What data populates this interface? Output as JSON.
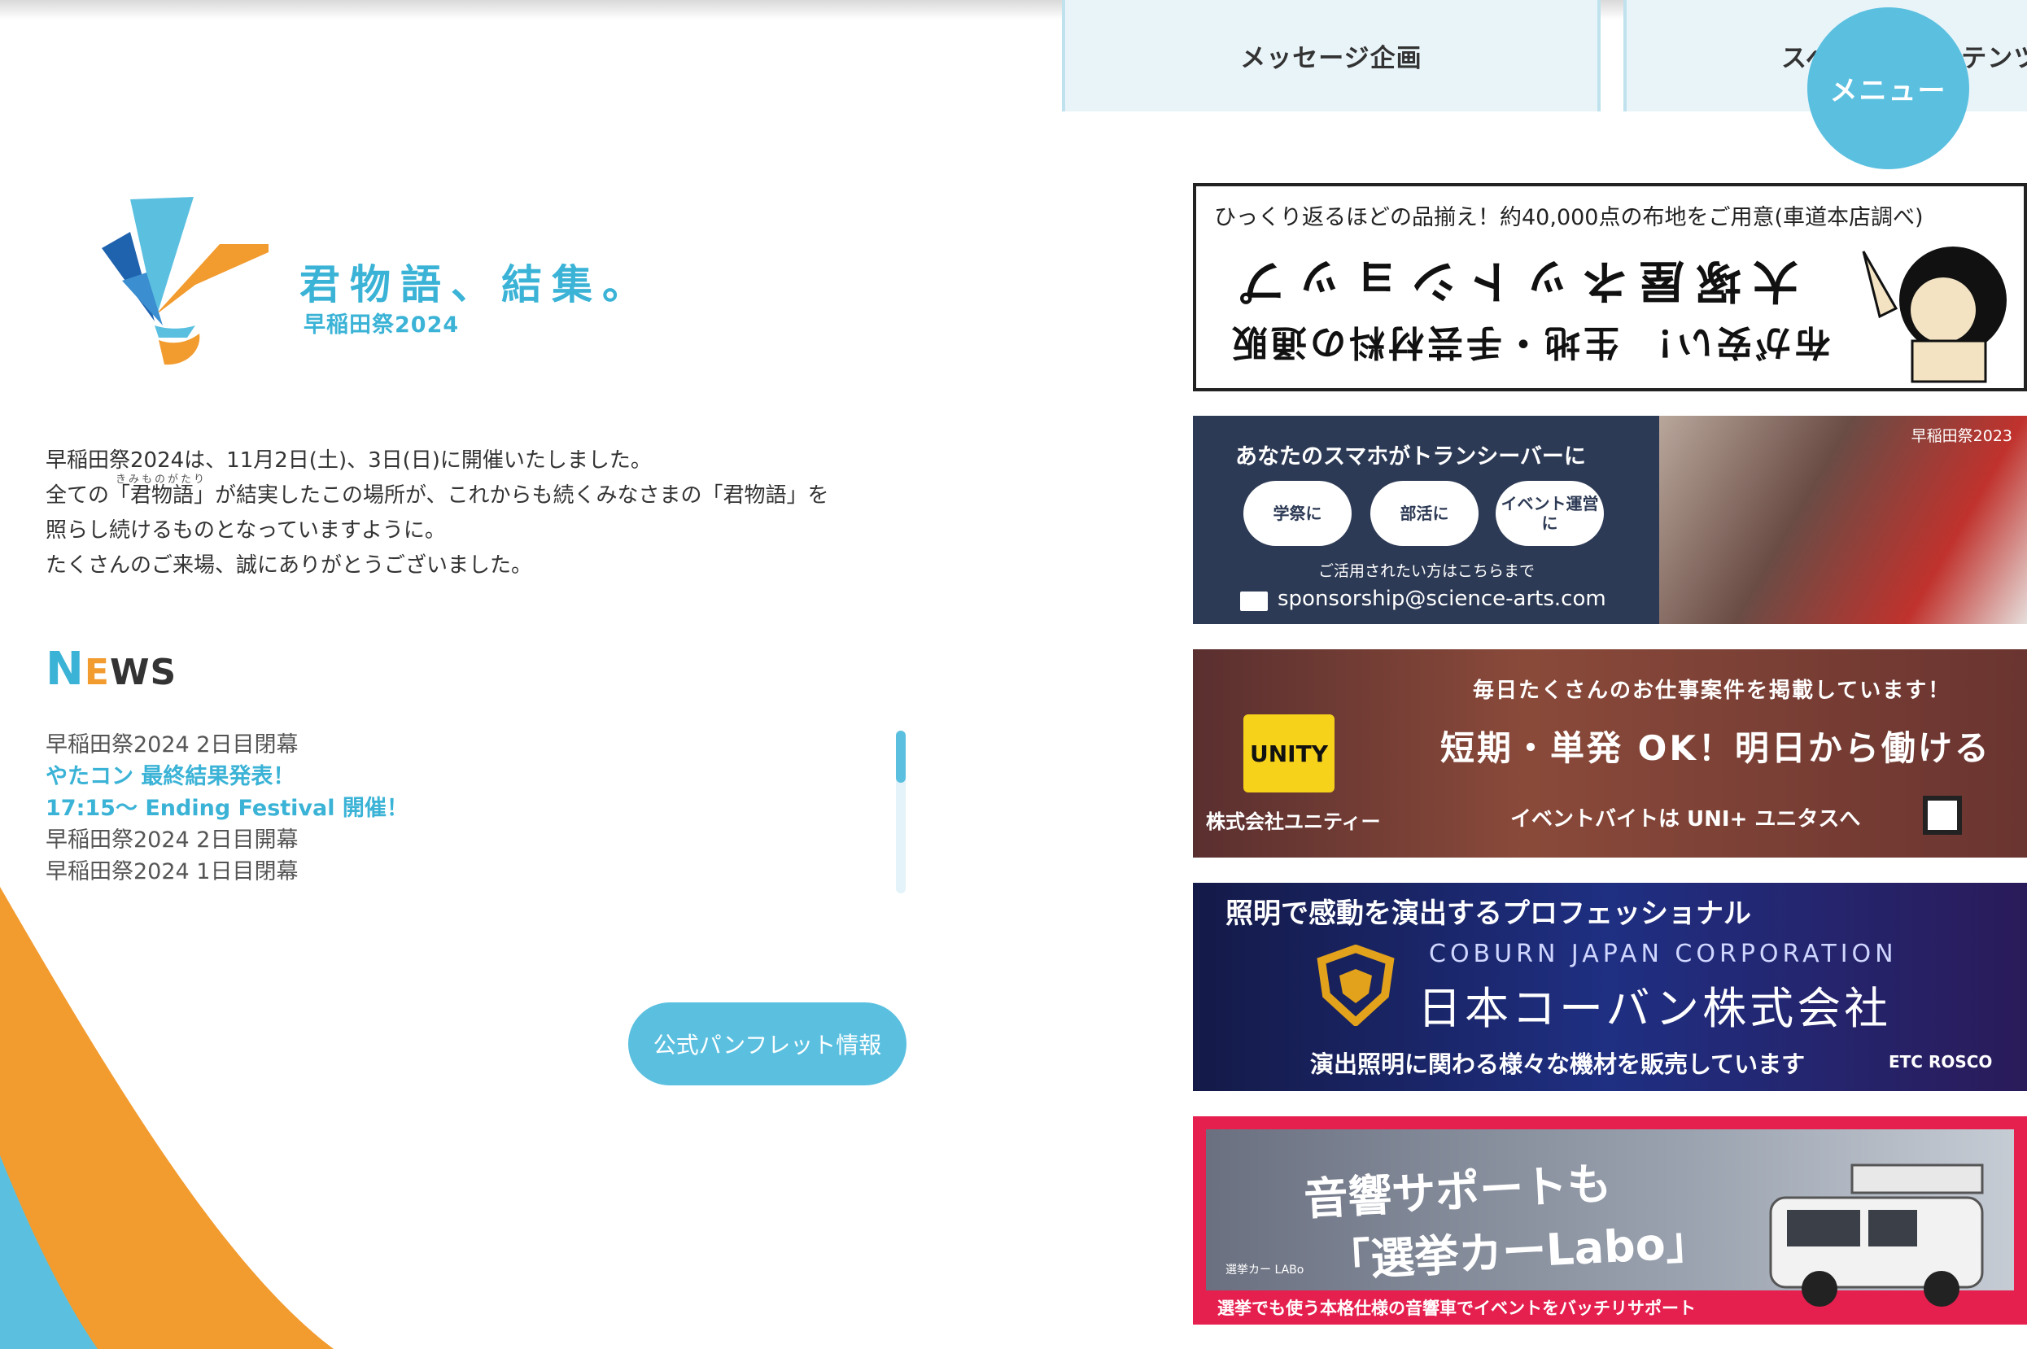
{
  "nav": {
    "tabs": [
      "メッセージ企画",
      "スペシャルコンテンツ"
    ]
  },
  "menu_button": "メニュー",
  "logo": {
    "title": "君物語、結集。",
    "subtitle": "早稲田祭2024"
  },
  "intro": {
    "lines": [
      "早稲田祭2024は、11月2日(土)、3日(日)に開催いたしました。",
      "全ての「君物語」が結実したこの場所が、これからも続くみなさまの「君物語」を",
      "照らし続けるものとなっていますように。",
      "たくさんのご来場、誠にありがとうございました。"
    ],
    "ruby": "きみものがたり"
  },
  "news": {
    "heading_n": "N",
    "heading_e": "E",
    "heading_rest": "WS",
    "items": [
      "早稲田祭2024 2日目閉幕",
      "やたコン 最終結果発表！",
      "17:15〜 Ending Festival 開催！",
      "早稲田祭2024 2日目開幕",
      "早稲田祭2024 1日目閉幕"
    ]
  },
  "pamphlet_button": "公式パンフレット情報",
  "banners": {
    "b1": {
      "line1": "ひっくり返るほどの品揃え！約40,000点の布地をご用意(車道本店調べ)",
      "line2": "大塚屋ネットショップ",
      "line3": "布が安い！ 生地・手芸材料の通販"
    },
    "b2": {
      "headline": "あなたのスマホがトランシーバーに",
      "pills": [
        "学祭に",
        "部活に",
        "イベント運営に"
      ],
      "contact": "ご活用されたい方はこちらまで",
      "email": "sponsorship@science-arts.com",
      "tag": "早稲田祭2023"
    },
    "b3": {
      "line1": "毎日たくさんのお仕事案件を掲載しています！",
      "line2": "短期・単発 OK！明日から働ける",
      "logo": "UNITY",
      "company": "株式会社ユニティー",
      "line3": "イベントバイトは UNI+ ユニタスへ"
    },
    "b4": {
      "line1": "照明で感動を演出するプロフェッショナル",
      "line2": "COBURN JAPAN CORPORATION",
      "line3": "日本コーバン株式会社",
      "line4": "演出照明に関わる様々な機材を販売しています",
      "brand": "ETC ROSCO"
    },
    "b5": {
      "line1": "音響サポートも",
      "line2": "「選挙カーLabo」",
      "small": "選挙カー LABo",
      "footer": "選挙でも使う本格仕様の音響車でイベントをバッチリサポート"
    }
  },
  "colors": {
    "accent_blue": "#5bc0e0",
    "logo_blue": "#3bb3d6",
    "accent_orange": "#f29b2f",
    "deep_blue": "#1f62ae"
  }
}
